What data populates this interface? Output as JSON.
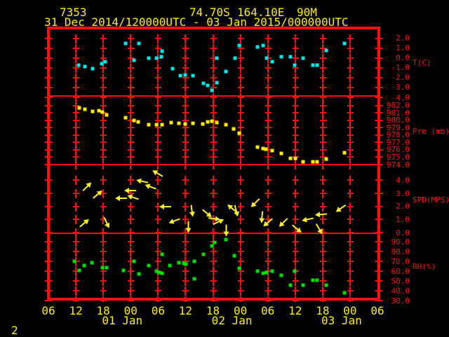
{
  "header": {
    "station_id": "7353",
    "latitude": "74.70S",
    "longitude": "164.10E",
    "elevation": "90M",
    "time_range": "31 Dec 2014/120000UTC - 03 Jan 2015/000000UTC"
  },
  "footer": {
    "page_number": "2"
  },
  "x_axis": {
    "hour_labels": [
      "06",
      "12",
      "18",
      "00",
      "06",
      "12",
      "18",
      "00",
      "06",
      "12",
      "18",
      "00",
      "06"
    ],
    "day_labels": [
      "01 Jan",
      "02 Jan",
      "03 Jan"
    ],
    "start": "31 Dec 2014 06UTC",
    "end": "03 Jan 2015 06UTC",
    "tick_interval_hours": 6
  },
  "colors": {
    "frame_and_grid": "#fb0f0f",
    "axis_text": "#ffee00",
    "temperature_points": "#00e8e8",
    "pressure_points": "#ffee00",
    "wind_arrows": "#ffee33",
    "humidity_points": "#00dd00"
  },
  "chart_data": [
    {
      "type": "scatter",
      "name": "temperature",
      "unit_label": "T(C)",
      "color": "#00e8e8",
      "tick_labels": [
        "2.0",
        "1.0",
        "0.0",
        "-1.0",
        "-2.0",
        "-3.0",
        "-4.0"
      ],
      "x_unit": "hours since 31 Dec 2014 06UTC",
      "points": [
        [
          6.6,
          -0.7
        ],
        [
          8.0,
          -0.9
        ],
        [
          9.7,
          -1.1
        ],
        [
          11.6,
          -0.6
        ],
        [
          12.4,
          -0.4
        ],
        [
          16.9,
          1.5
        ],
        [
          18.8,
          -0.2
        ],
        [
          19.8,
          1.5
        ],
        [
          21.9,
          0.0
        ],
        [
          23.6,
          0.0
        ],
        [
          24.7,
          0.1
        ],
        [
          24.9,
          0.7
        ],
        [
          27.1,
          -1.1
        ],
        [
          28.8,
          -1.8
        ],
        [
          29.9,
          -1.7
        ],
        [
          31.7,
          -1.8
        ],
        [
          33.9,
          -2.6
        ],
        [
          34.8,
          -2.8
        ],
        [
          35.7,
          -3.3
        ],
        [
          36.8,
          -2.5
        ],
        [
          36.9,
          0.0
        ],
        [
          38.8,
          -1.4
        ],
        [
          40.9,
          0.0
        ],
        [
          41.8,
          1.3
        ],
        [
          45.8,
          1.1
        ],
        [
          46.9,
          1.3
        ],
        [
          47.8,
          0.0
        ],
        [
          48.9,
          -0.4
        ],
        [
          50.9,
          0.1
        ],
        [
          52.9,
          0.1
        ],
        [
          53.9,
          -0.7
        ],
        [
          55.8,
          0.0
        ],
        [
          57.8,
          -0.7
        ],
        [
          58.8,
          -0.7
        ],
        [
          60.8,
          0.8
        ],
        [
          64.8,
          1.5
        ]
      ]
    },
    {
      "type": "scatter",
      "name": "pressure",
      "unit_label": "Pre (mb)",
      "color": "#ffee00",
      "tick_labels": [
        "982.0",
        "981.0",
        "980.0",
        "979.0",
        "978.0",
        "977.0",
        "976.0",
        "975.0",
        "974.0"
      ],
      "x_unit": "hours since 31 Dec 2014 06UTC",
      "points": [
        [
          6.7,
          981.7
        ],
        [
          8.0,
          981.5
        ],
        [
          9.7,
          981.2
        ],
        [
          11.0,
          981.3
        ],
        [
          11.8,
          981.1
        ],
        [
          12.7,
          980.7
        ],
        [
          16.9,
          980.4
        ],
        [
          18.8,
          980.0
        ],
        [
          19.6,
          979.8
        ],
        [
          21.9,
          979.4
        ],
        [
          23.7,
          979.4
        ],
        [
          24.8,
          979.4
        ],
        [
          26.8,
          979.7
        ],
        [
          28.6,
          979.6
        ],
        [
          29.9,
          979.5
        ],
        [
          31.7,
          979.6
        ],
        [
          33.7,
          979.5
        ],
        [
          34.8,
          979.8
        ],
        [
          35.7,
          979.9
        ],
        [
          36.9,
          979.7
        ],
        [
          38.8,
          979.4
        ],
        [
          40.6,
          978.8
        ],
        [
          41.8,
          978.3
        ],
        [
          45.8,
          976.4
        ],
        [
          46.9,
          976.2
        ],
        [
          47.6,
          976.1
        ],
        [
          48.9,
          975.9
        ],
        [
          50.9,
          975.5
        ],
        [
          52.9,
          974.9
        ],
        [
          54.1,
          974.9
        ],
        [
          55.8,
          974.4
        ],
        [
          57.8,
          974.4
        ],
        [
          58.8,
          974.4
        ],
        [
          60.8,
          974.8
        ],
        [
          64.8,
          975.6
        ]
      ]
    },
    {
      "type": "wind_vectors",
      "name": "wind_speed",
      "unit_label": "SPD(MPS)",
      "color": "#ffee33",
      "tick_labels": [
        "4.0",
        "3.0",
        "2.0",
        "1.0",
        "0.0"
      ],
      "x_unit": "hours since 31 Dec 2014 06UTC",
      "arrows_note": "[t_hours, speed_mps, screen_direction_deg_ccw_from_east]",
      "arrows": [
        [
          7.7,
          0.7,
          40
        ],
        [
          8.3,
          3.5,
          45
        ],
        [
          10.6,
          2.9,
          40
        ],
        [
          12.6,
          0.8,
          -65
        ],
        [
          16.1,
          2.6,
          180
        ],
        [
          18.1,
          3.2,
          180
        ],
        [
          18.7,
          2.7,
          162
        ],
        [
          20.7,
          3.9,
          168
        ],
        [
          22.5,
          3.5,
          160
        ],
        [
          24.0,
          4.5,
          150
        ],
        [
          25.7,
          2.0,
          180
        ],
        [
          27.7,
          0.9,
          200
        ],
        [
          30.6,
          0.5,
          -90
        ],
        [
          31.4,
          1.7,
          -82
        ],
        [
          34.6,
          1.5,
          -40
        ],
        [
          36.2,
          1.1,
          -8
        ],
        [
          37.1,
          0.8,
          25
        ],
        [
          38.9,
          0.2,
          -90
        ],
        [
          40.3,
          1.8,
          140
        ],
        [
          41.1,
          1.7,
          -75
        ],
        [
          45.3,
          2.3,
          -135
        ],
        [
          46.8,
          1.25,
          -95
        ],
        [
          48.2,
          0.8,
          -140
        ],
        [
          51.5,
          0.8,
          -135
        ],
        [
          54.3,
          0.35,
          -40
        ],
        [
          56.9,
          1.0,
          -168
        ],
        [
          59.2,
          0.35,
          -60
        ],
        [
          59.8,
          1.4,
          -175
        ],
        [
          64.1,
          1.9,
          -145
        ]
      ]
    },
    {
      "type": "scatter",
      "name": "relative_humidity",
      "unit_label": "RH(%)",
      "color": "#00dd00",
      "tick_labels": [
        "90.0",
        "80.0",
        "70.0",
        "60.0",
        "50.0",
        "40.0",
        "30.0"
      ],
      "x_unit": "hours since 31 Dec 2014 06UTC",
      "points": [
        [
          5.7,
          70
        ],
        [
          6.7,
          61
        ],
        [
          7.8,
          66
        ],
        [
          9.5,
          69
        ],
        [
          11.8,
          64
        ],
        [
          12.7,
          64
        ],
        [
          16.5,
          61
        ],
        [
          18.8,
          70
        ],
        [
          19.8,
          57
        ],
        [
          21.9,
          66
        ],
        [
          23.6,
          60
        ],
        [
          24.1,
          59
        ],
        [
          24.8,
          58
        ],
        [
          24.9,
          77
        ],
        [
          26.6,
          66
        ],
        [
          28.6,
          69
        ],
        [
          29.7,
          68
        ],
        [
          30.1,
          67
        ],
        [
          31.9,
          52
        ],
        [
          32.0,
          70
        ],
        [
          33.9,
          77
        ],
        [
          35.7,
          86
        ],
        [
          36.4,
          89
        ],
        [
          38.8,
          92
        ],
        [
          40.7,
          76
        ],
        [
          41.8,
          63
        ],
        [
          45.8,
          60
        ],
        [
          46.9,
          58
        ],
        [
          47.8,
          59
        ],
        [
          48.9,
          60
        ],
        [
          50.9,
          56
        ],
        [
          52.9,
          46
        ],
        [
          53.9,
          60
        ],
        [
          55.8,
          46
        ],
        [
          57.8,
          51
        ],
        [
          58.8,
          51
        ],
        [
          60.8,
          46
        ],
        [
          64.8,
          38
        ]
      ]
    }
  ]
}
